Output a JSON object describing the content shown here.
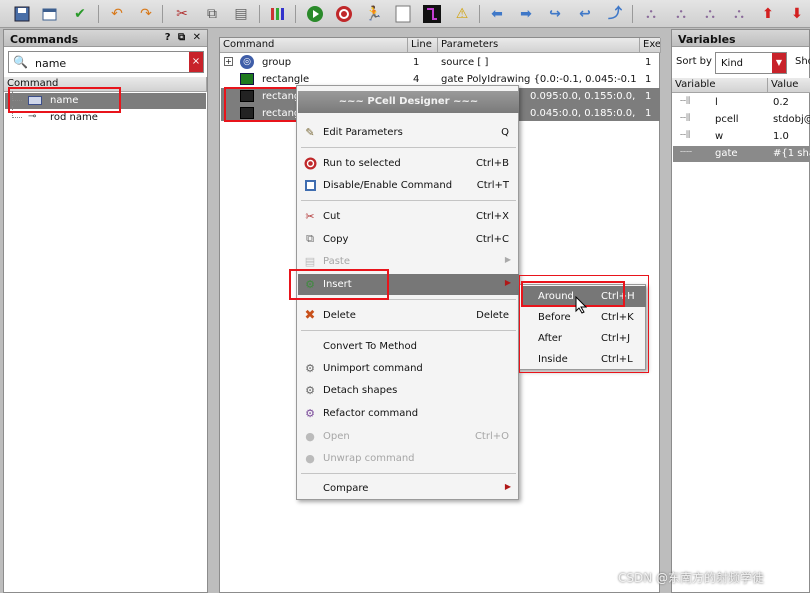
{
  "toolbar": {
    "icons": [
      "save-icon",
      "window-icon",
      "check-icon",
      "undo-icon",
      "redo-icon",
      "cut-icon",
      "copy-icon",
      "paste-icon",
      "grid-icon",
      "run-icon",
      "stop-icon",
      "step-icon",
      "blank-icon",
      "layout-icon",
      "warning-icon",
      "arrow-left-icon",
      "arrow-right-icon",
      "curve-left-icon",
      "curve-right-icon",
      "curve-up-icon",
      "tree-icon",
      "tree-search-icon",
      "tree-gear-icon",
      "tree-add-icon",
      "arrow-up-icon",
      "arrow-down-icon"
    ]
  },
  "commands_panel": {
    "title": "Commands",
    "title_buttons": "? ⧉ ✕",
    "search_value": "name",
    "column_header": "Command",
    "items": [
      {
        "label": "name",
        "selected": true
      },
      {
        "label": "rod name",
        "selected": false
      }
    ]
  },
  "editor": {
    "columns": [
      "Command",
      "Line",
      "Parameters",
      "Exe"
    ],
    "rows": [
      {
        "command": "group",
        "line": "1",
        "params": "source [ ]",
        "exe": "1",
        "selected": false
      },
      {
        "command": "rectangle",
        "line": "4",
        "params": "gate PolyIdrawing {0.0:-0.1, 0.045:-0.1, ...",
        "exe": "1",
        "selected": false
      },
      {
        "command": "rectang",
        "line": "",
        "params": "0.095:0.0, 0.155:0.0, 0....",
        "exe": "1",
        "selected": true
      },
      {
        "command": "rectang",
        "line": "",
        "params": "0.045:0.0, 0.185:0.0, 0....",
        "exe": "1",
        "selected": true
      }
    ]
  },
  "context_menu": {
    "title": "~~~ PCell Designer ~~~",
    "items": [
      {
        "label": "Edit Parameters",
        "shortcut": "Q",
        "icon": "wrench-icon",
        "disabled": false
      },
      {
        "label": "Run to selected",
        "shortcut": "Ctrl+B",
        "icon": "run-icon",
        "disabled": false
      },
      {
        "label": "Disable/Enable Command",
        "shortcut": "Ctrl+T",
        "icon": "toggle-icon",
        "disabled": false
      },
      {
        "label": "Cut",
        "shortcut": "Ctrl+X",
        "icon": "scissors-icon",
        "disabled": false
      },
      {
        "label": "Copy",
        "shortcut": "Ctrl+C",
        "icon": "copy-icon",
        "disabled": false
      },
      {
        "label": "Paste",
        "shortcut": "",
        "icon": "paste-icon",
        "disabled": true
      },
      {
        "label": "Insert",
        "shortcut": "",
        "icon": "insert-icon",
        "disabled": false
      },
      {
        "label": "Delete",
        "shortcut": "Delete",
        "icon": "delete-x-icon",
        "disabled": false
      },
      {
        "label": "Convert To Method",
        "shortcut": "",
        "icon": "",
        "disabled": false
      },
      {
        "label": "Unimport command",
        "shortcut": "",
        "icon": "gear-icon",
        "disabled": false
      },
      {
        "label": "Detach shapes",
        "shortcut": "",
        "icon": "gear-icon",
        "disabled": false
      },
      {
        "label": "Refactor command",
        "shortcut": "",
        "icon": "refactor-icon",
        "disabled": false
      },
      {
        "label": "Open",
        "shortcut": "Ctrl+O",
        "icon": "open-icon",
        "disabled": true
      },
      {
        "label": "Unwrap command",
        "shortcut": "",
        "icon": "unwrap-icon",
        "disabled": true
      },
      {
        "label": "Compare",
        "shortcut": "",
        "icon": "",
        "disabled": false
      }
    ]
  },
  "insert_submenu": {
    "items": [
      {
        "label": "Around",
        "shortcut": "Ctrl+H"
      },
      {
        "label": "Before",
        "shortcut": "Ctrl+K"
      },
      {
        "label": "After",
        "shortcut": "Ctrl+J"
      },
      {
        "label": "Inside",
        "shortcut": "Ctrl+L"
      }
    ]
  },
  "variables_panel": {
    "title": "Variables",
    "sort_label": "Sort by",
    "sort_value": "Kind",
    "show_label": "Sho",
    "columns": [
      "Variable",
      "Value"
    ],
    "rows": [
      {
        "name": "l",
        "value": "0.2"
      },
      {
        "name": "pcell",
        "value": "stdobj@"
      },
      {
        "name": "w",
        "value": "1.0"
      },
      {
        "name": "gate",
        "value": "#{1 sha"
      }
    ]
  },
  "watermark": "CSDN @东南方的射频学徒",
  "colors": {
    "highlight_red": "#e8141b",
    "selection_grey": "#7d7d7d",
    "menu_highlight": "#777777"
  }
}
